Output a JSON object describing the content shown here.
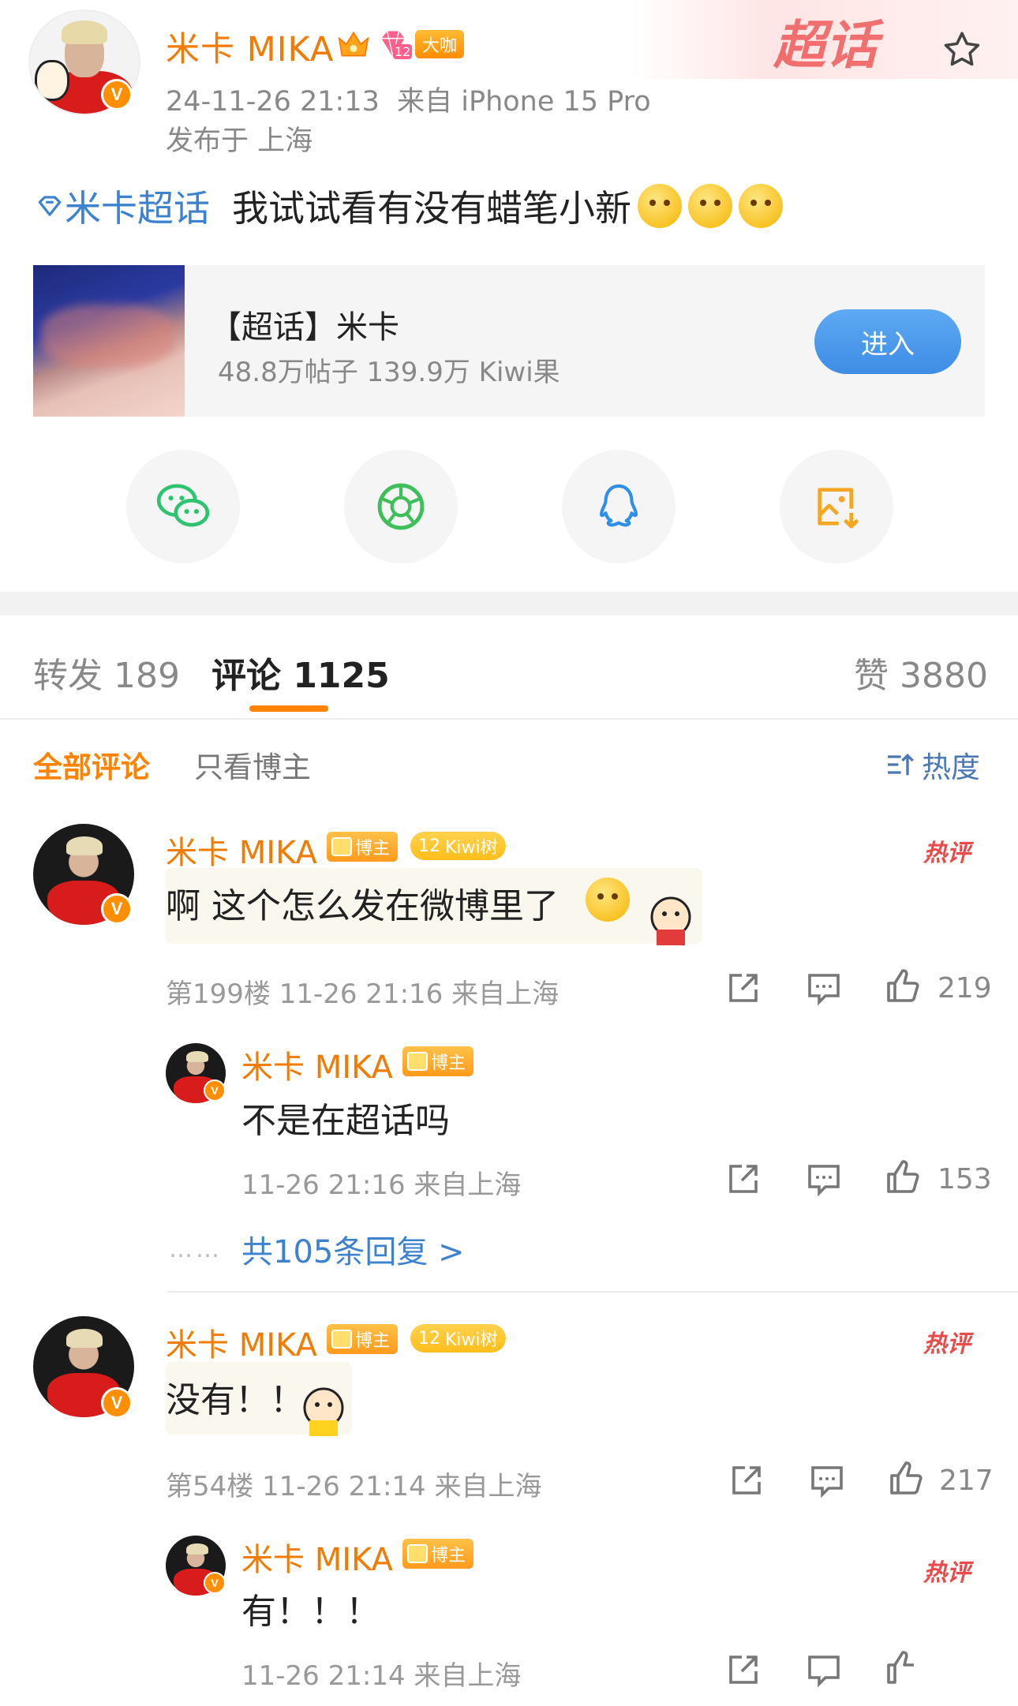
{
  "post": {
    "author": "米卡 MIKA",
    "level_badge": "12",
    "vip_badge": "大咖",
    "time": "24-11-26 21:13",
    "source": "来自 iPhone 15 Pro",
    "location": "发布于 上海",
    "supertopic_watermark": "超话",
    "topic_link": "米卡超话",
    "text": "我试试看有没有蜡笔小新",
    "icons": [
      "verified-icon",
      "crown-icon",
      "diamond-icon",
      "star-icon",
      "supertopic-diamond-icon"
    ]
  },
  "topic_card": {
    "title": "【超话】米卡",
    "stats": "48.8万帖子 139.9万 Kiwi果",
    "button": "进入"
  },
  "share": {
    "items": [
      "wechat-icon",
      "moments-icon",
      "qq-icon",
      "save-image-icon"
    ],
    "colors": {
      "wechat": "#2fc36f",
      "moments": "#3fbf5a",
      "qq": "#2d8fe8",
      "save": "#f5a623"
    }
  },
  "tabs": {
    "repost": "转发 189",
    "comment": "评论 1125",
    "like": "赞 3880"
  },
  "filters": {
    "all": "全部评论",
    "op_only": "只看博主",
    "sort": "热度"
  },
  "comments": [
    {
      "name": "米卡 MIKA",
      "badge_host": "博主",
      "badge_kiwi_level": "12",
      "badge_kiwi": "Kiwi树",
      "hot": "热评",
      "text": "啊 这个怎么发在微博里了",
      "meta": "第199楼 11-26 21:16 来自上海",
      "likes": "219"
    },
    {
      "name": "米卡 MIKA",
      "badge_host": "博主",
      "text": "不是在超话吗",
      "meta": "11-26 21:16 来自上海",
      "likes": "153"
    },
    {
      "more": "共105条回复 >",
      "dots": "……"
    },
    {
      "name": "米卡 MIKA",
      "badge_host": "博主",
      "badge_kiwi_level": "12",
      "badge_kiwi": "Kiwi树",
      "hot": "热评",
      "text": "没有！！",
      "meta": "第54楼 11-26 21:14 来自上海",
      "likes": "217"
    },
    {
      "name": "米卡 MIKA",
      "badge_host": "博主",
      "hot": "热评",
      "text": "有！！！",
      "meta": "11-26 21:14 来自上海"
    }
  ],
  "colors": {
    "accent_orange": "#ff8200",
    "name_orange": "#f07c05",
    "link_blue": "#3c82cf",
    "hot_red": "#e84b4b"
  }
}
